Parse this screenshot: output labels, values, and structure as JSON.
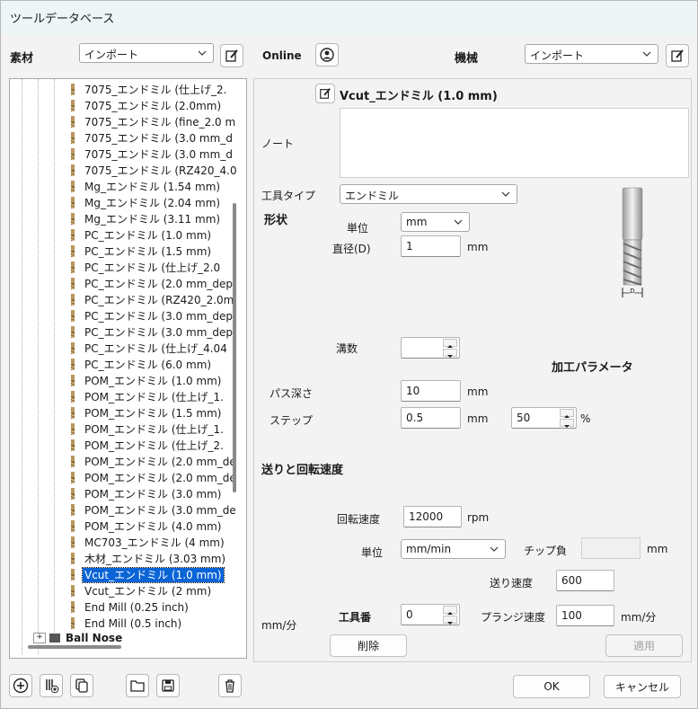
{
  "window": {
    "title": "ツールデータベース"
  },
  "left_header": {
    "material_label": "素材",
    "material_combo": "インポート",
    "online_label": "Online"
  },
  "right_header": {
    "machine_label": "機械",
    "machine_combo": "インポート"
  },
  "tree": {
    "items": [
      "7075_エンドミル (仕上げ_2.",
      "7075_エンドミル (2.0mm)",
      "7075_エンドミル (fine_2.0 m",
      "7075_エンドミル (3.0 mm_d",
      "7075_エンドミル (3.0 mm_d",
      "7075_エンドミル (RZ420_4.0",
      "Mg_エンドミル (1.54 mm)",
      "Mg_エンドミル (2.04 mm)",
      "Mg_エンドミル (3.11 mm)",
      "PC_エンドミル (1.0 mm)",
      "PC_エンドミル (1.5 mm)",
      "PC_エンドミル (仕上げ_2.0",
      "PC_エンドミル (2.0 mm_dep",
      "PC_エンドミル (RZ420_2.0m",
      "PC_エンドミル (3.0 mm_dep",
      "PC_エンドミル (3.0 mm_dep",
      "PC_エンドミル (仕上げ_4.04",
      "PC_エンドミル (6.0 mm)",
      "POM_エンドミル (1.0 mm)",
      "POM_エンドミル (仕上げ_1.",
      "POM_エンドミル (1.5 mm)",
      "POM_エンドミル (仕上げ_1.",
      "POM_エンドミル (仕上げ_2.",
      "POM_エンドミル (2.0 mm_de",
      "POM_エンドミル (2.0 mm_de",
      "POM_エンドミル (3.0 mm)",
      "POM_エンドミル (3.0 mm_de",
      "POM_エンドミル (4.0 mm)",
      "MC703_エンドミル (4 mm)",
      "木材_エンドミル (3.03 mm)",
      "Vcut_エンドミル (1.0 mm)",
      "Vcut_エンドミル (2 mm)",
      "End Mill (0.25 inch)",
      "End Mill (0.5 inch)"
    ],
    "selected_index": 30,
    "folder_label": "Ball Nose"
  },
  "tool": {
    "name": "Vcut_エンドミル (1.0 mm)",
    "note_label": "ノート",
    "note_value": "",
    "tool_type_label": "工具タイプ",
    "tool_type_value": "エンドミル",
    "shape_label": "形状",
    "unit_label": "単位",
    "unit_value": "mm",
    "diameter_label": "直径(D)",
    "diameter_value": "1",
    "diameter_unit": "mm",
    "diagram_label": "D",
    "flutes_label": "溝数",
    "flutes_value": ""
  },
  "params": {
    "section_label": "加工パラメータ",
    "pass_depth_label": "パス深さ",
    "pass_depth_value": "10",
    "pass_depth_unit": "mm",
    "step_label": "ステップ",
    "step_value": "0.5",
    "step_unit": "mm",
    "step_percent_value": "50",
    "step_percent_unit": "%"
  },
  "feeds": {
    "section_label": "送りと回転速度",
    "spindle_label": "回転速度",
    "spindle_value": "12000",
    "spindle_unit": "rpm",
    "unit_label": "単位",
    "unit_value": "mm/min",
    "chip_load_label": "チップ負",
    "chip_load_value": "",
    "chip_load_unit": "mm",
    "feed_label": "送り速度",
    "feed_value": "600",
    "left_unit": "mm/分",
    "tool_number_label": "工具番",
    "tool_number_value": "0",
    "plunge_label": "プランジ速度",
    "plunge_value": "100",
    "plunge_unit": "mm/分"
  },
  "buttons": {
    "delete": "削除",
    "apply": "適用",
    "ok": "OK",
    "cancel": "キャンセル"
  },
  "colors": {
    "selection": "#0a64d6",
    "titlebar": "#eef5f7",
    "tool_icon": "#b9975b"
  }
}
